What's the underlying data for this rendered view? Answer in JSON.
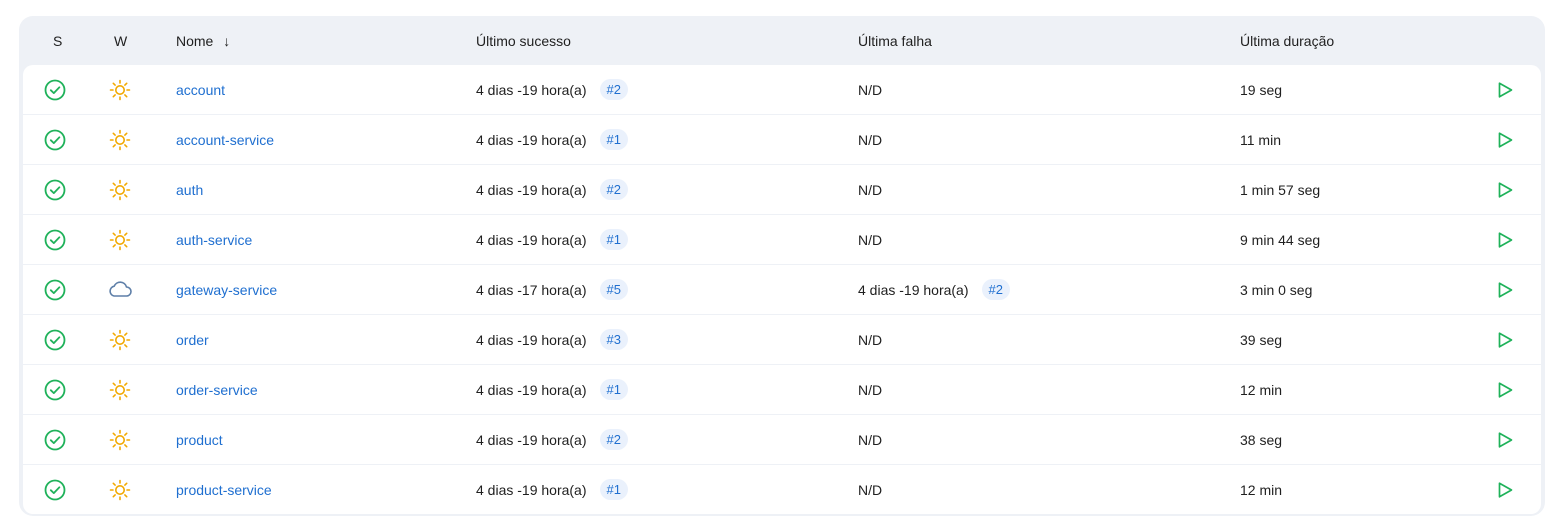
{
  "columns": {
    "status": "S",
    "weather": "W",
    "name": "Nome",
    "sort_indicator": "↓",
    "last_success": "Último sucesso",
    "last_failure": "Última falha",
    "last_duration": "Última duração"
  },
  "icons": {
    "status": "success-check-icon",
    "weather_sunny": "sun-icon",
    "weather_cloudy": "cloud-icon",
    "run": "play-icon"
  },
  "colors": {
    "success": "#1fb25a",
    "sun": "#f2a900",
    "cloud": "#5e7fa8",
    "link": "#1f6fd0",
    "badge_bg": "#eaf1fc",
    "table_bg": "#eef1f6"
  },
  "jobs": [
    {
      "name": "account",
      "weather": "sunny",
      "success_time": "4 dias -19 hora(a)",
      "success_build": "#2",
      "failure_time": "N/D",
      "failure_build": "",
      "duration": "19 seg"
    },
    {
      "name": "account-service",
      "weather": "sunny",
      "success_time": "4 dias -19 hora(a)",
      "success_build": "#1",
      "failure_time": "N/D",
      "failure_build": "",
      "duration": "11 min"
    },
    {
      "name": "auth",
      "weather": "sunny",
      "success_time": "4 dias -19 hora(a)",
      "success_build": "#2",
      "failure_time": "N/D",
      "failure_build": "",
      "duration": "1 min 57 seg"
    },
    {
      "name": "auth-service",
      "weather": "sunny",
      "success_time": "4 dias -19 hora(a)",
      "success_build": "#1",
      "failure_time": "N/D",
      "failure_build": "",
      "duration": "9 min 44 seg"
    },
    {
      "name": "gateway-service",
      "weather": "cloudy",
      "success_time": "4 dias -17 hora(a)",
      "success_build": "#5",
      "failure_time": "4 dias -19 hora(a)",
      "failure_build": "#2",
      "duration": "3 min 0 seg"
    },
    {
      "name": "order",
      "weather": "sunny",
      "success_time": "4 dias -19 hora(a)",
      "success_build": "#3",
      "failure_time": "N/D",
      "failure_build": "",
      "duration": "39 seg"
    },
    {
      "name": "order-service",
      "weather": "sunny",
      "success_time": "4 dias -19 hora(a)",
      "success_build": "#1",
      "failure_time": "N/D",
      "failure_build": "",
      "duration": "12 min"
    },
    {
      "name": "product",
      "weather": "sunny",
      "success_time": "4 dias -19 hora(a)",
      "success_build": "#2",
      "failure_time": "N/D",
      "failure_build": "",
      "duration": "38 seg"
    },
    {
      "name": "product-service",
      "weather": "sunny",
      "success_time": "4 dias -19 hora(a)",
      "success_build": "#1",
      "failure_time": "N/D",
      "failure_build": "",
      "duration": "12 min"
    }
  ]
}
